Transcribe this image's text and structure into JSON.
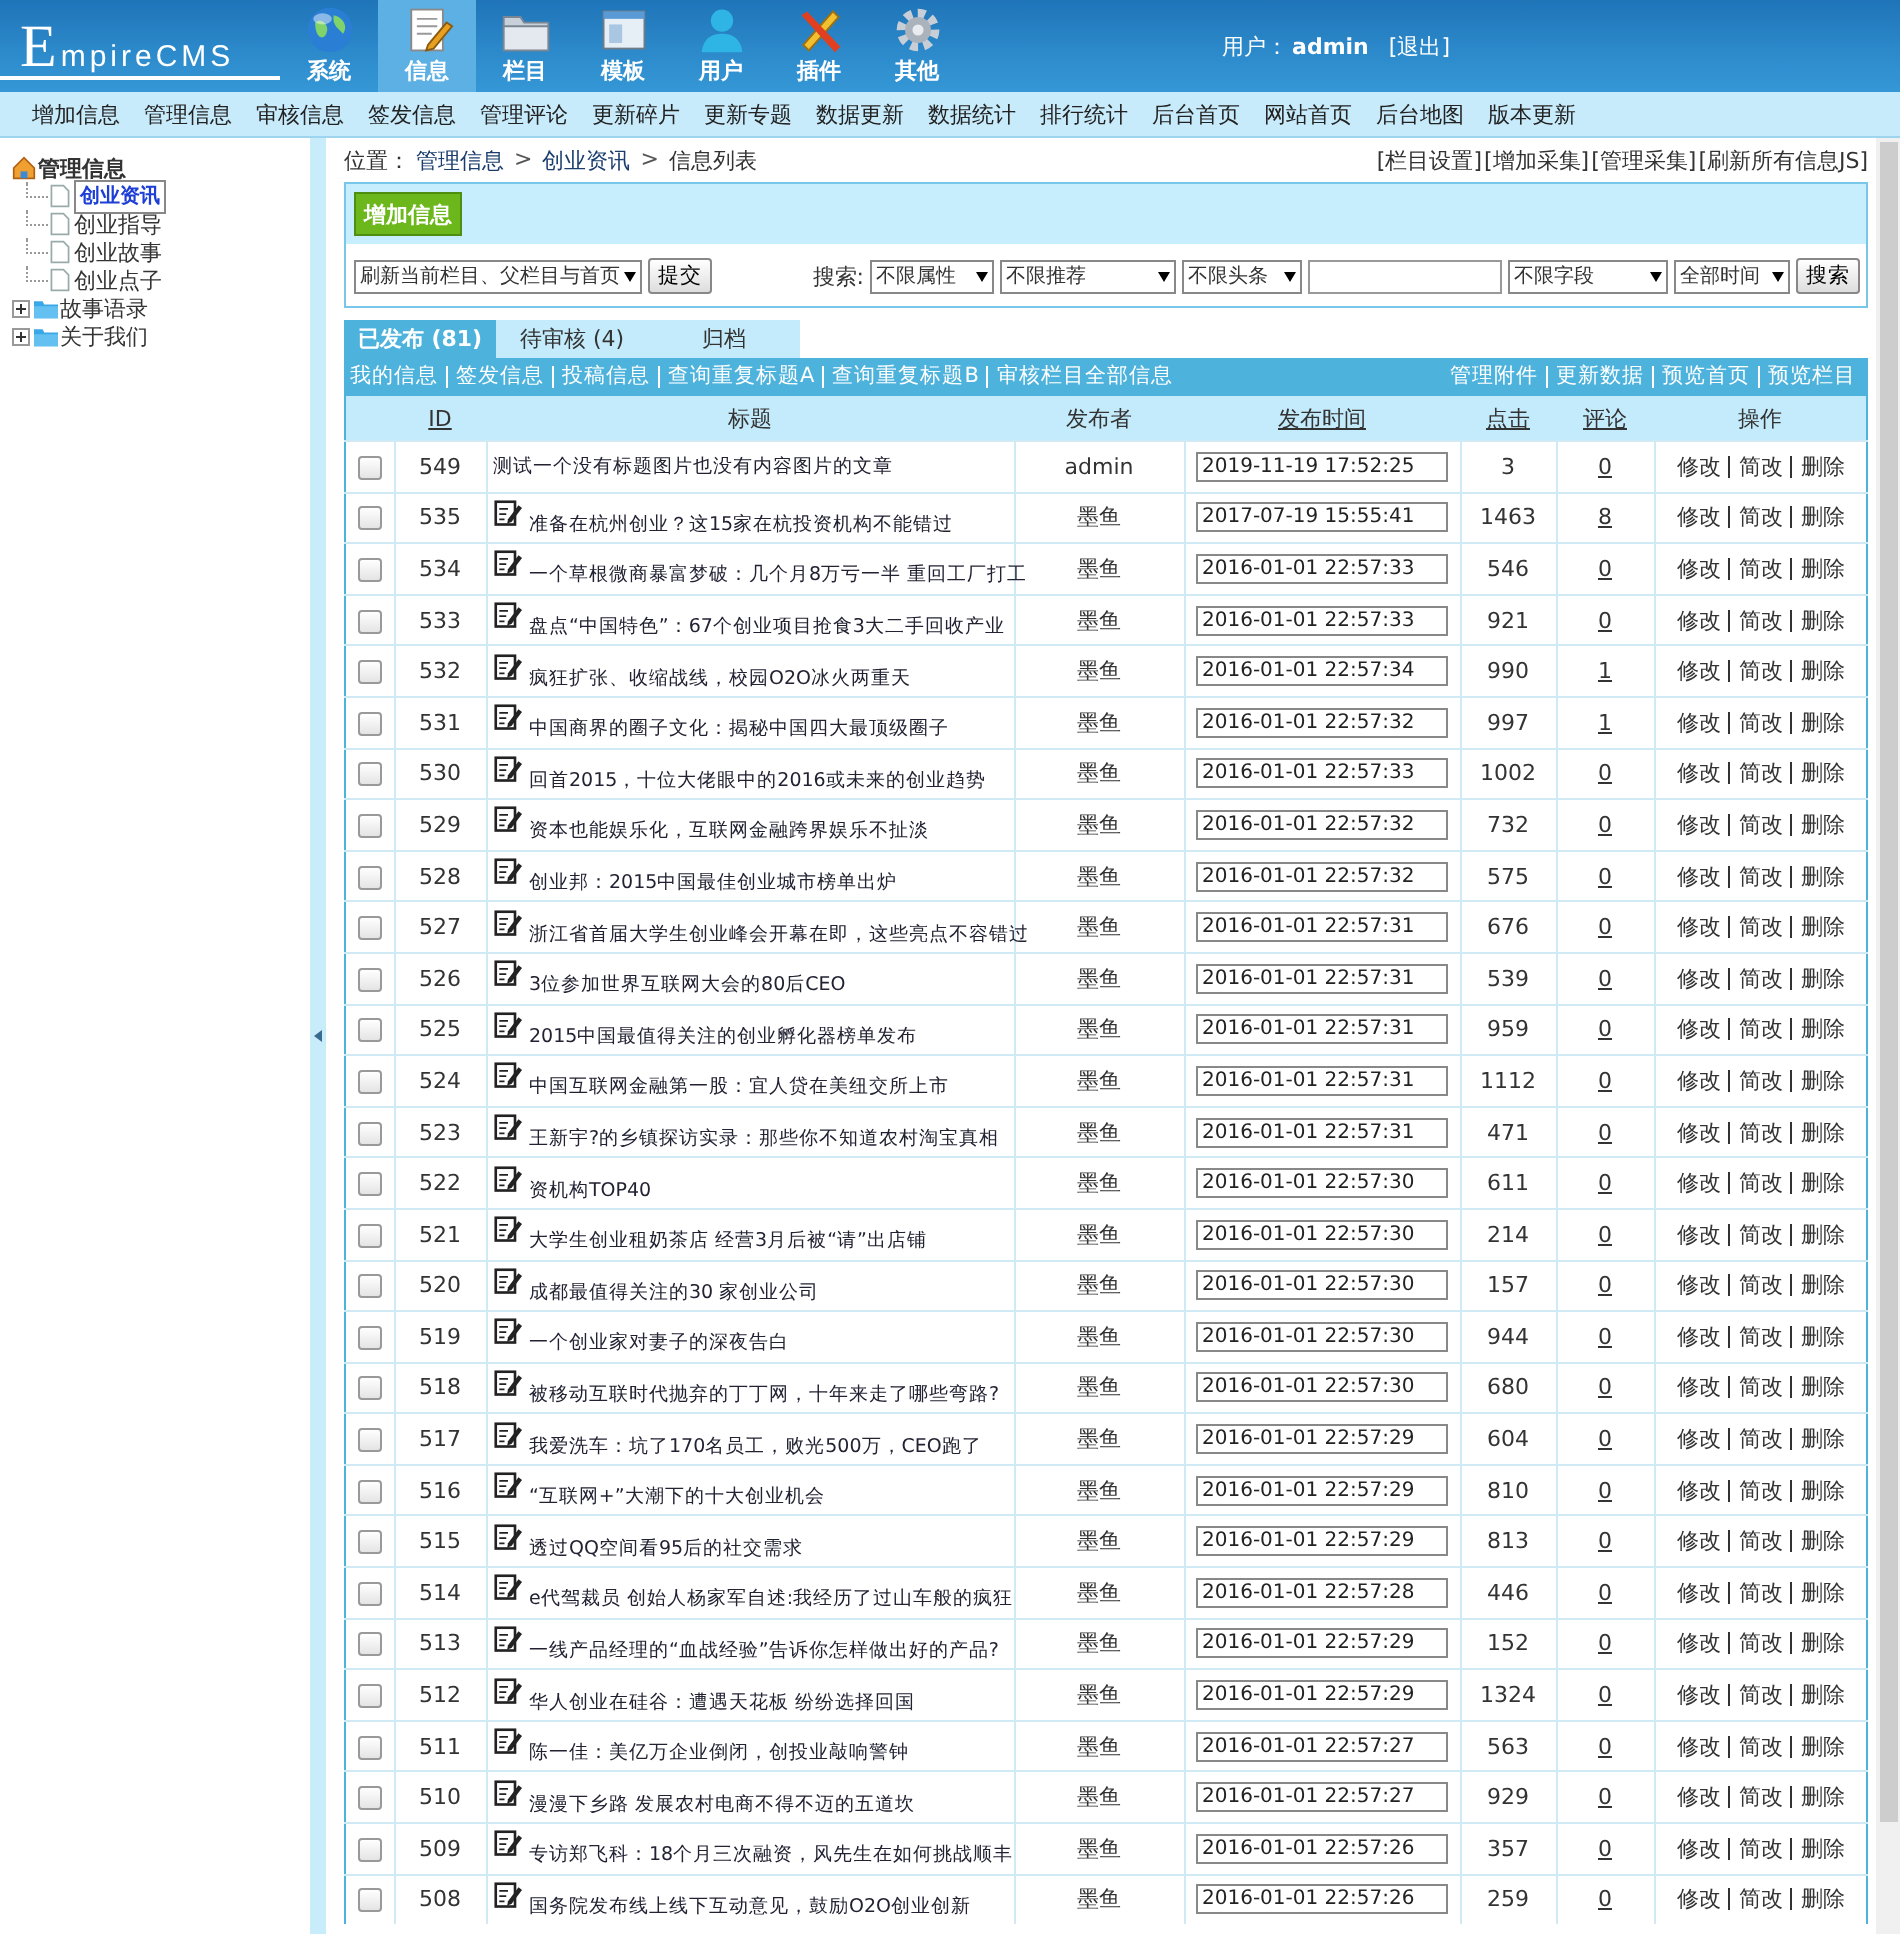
{
  "header": {
    "logo": "EmpireCMS",
    "nav": [
      {
        "label": "系统",
        "selected": false
      },
      {
        "label": "信息",
        "selected": true
      },
      {
        "label": "栏目",
        "selected": false
      },
      {
        "label": "模板",
        "selected": false
      },
      {
        "label": "用户",
        "selected": false
      },
      {
        "label": "插件",
        "selected": false
      },
      {
        "label": "其他",
        "selected": false
      }
    ],
    "user": {
      "label": "用户：",
      "name": "admin",
      "logout": "[退出]"
    }
  },
  "menu": [
    "增加信息",
    "管理信息",
    "审核信息",
    "签发信息",
    "管理评论",
    "更新碎片",
    "更新专题",
    "数据更新",
    "数据统计",
    "排行统计",
    "后台首页",
    "网站首页",
    "后台地图",
    "版本更新"
  ],
  "sidebar": {
    "tree": [
      {
        "label": "管理信息",
        "kind": "root",
        "expanded": true,
        "children": [
          {
            "label": "创业资讯",
            "kind": "page",
            "selected": true
          },
          {
            "label": "创业指导",
            "kind": "page",
            "selected": false
          },
          {
            "label": "创业故事",
            "kind": "page",
            "selected": false
          },
          {
            "label": "创业点子",
            "kind": "page",
            "selected": false
          }
        ]
      },
      {
        "label": "故事语录",
        "kind": "folder",
        "expanded": false
      },
      {
        "label": "关于我们",
        "kind": "folder",
        "expanded": false
      }
    ]
  },
  "breadcrumb": {
    "label": "位置：",
    "parts": [
      {
        "text": "管理信息",
        "kind": "link"
      },
      {
        "text": ">",
        "kind": "sep"
      },
      {
        "text": "创业资讯",
        "kind": "link"
      },
      {
        "text": ">",
        "kind": "sep"
      },
      {
        "text": "信息列表",
        "kind": "text"
      }
    ]
  },
  "top_links": [
    "[栏目设置]",
    "[增加采集]",
    "[管理采集]",
    "[刷新所有信息JS]"
  ],
  "toolbar": {
    "add_button": "增加信息",
    "refresh_select": "刷新当前栏目、父栏目与首页",
    "submit_button": "提交",
    "search_label": "搜索:",
    "filters": [
      "不限属性",
      "不限推荐",
      "不限头条"
    ],
    "field_select": "不限字段",
    "time_select": "全部时间",
    "search_button": "搜索"
  },
  "tabs": [
    {
      "label": "已发布 (81)",
      "selected": true
    },
    {
      "label": "待审核 (4)",
      "selected": false
    },
    {
      "label": "归档",
      "selected": false
    }
  ],
  "links_left": [
    "我的信息",
    "签发信息",
    "投稿信息",
    "查询重复标题A",
    "查询重复标题B",
    "审核栏目全部信息"
  ],
  "links_right": [
    "管理附件",
    "更新数据",
    "预览首页",
    "预览栏目"
  ],
  "table": {
    "columns": [
      {
        "label": "ID",
        "link": true
      },
      {
        "label": "标题",
        "link": false
      },
      {
        "label": "发布者",
        "link": false
      },
      {
        "label": "发布时间",
        "link": true
      },
      {
        "label": "点击",
        "link": true
      },
      {
        "label": "评论",
        "link": true
      },
      {
        "label": "操作",
        "link": false
      }
    ],
    "rows": [
      {
        "checked": false,
        "id": "549",
        "has_image": false,
        "title": "测试一个没有标题图片也没有内容图片的文章",
        "publisher": "admin",
        "time": "2019-11-19 17:52:25",
        "clicks": "3",
        "comments": "0",
        "actions": [
          "修改",
          "简改",
          "删除"
        ]
      },
      {
        "checked": false,
        "id": "535",
        "has_image": true,
        "title": "准备在杭州创业？这15家在杭投资机构不能错过",
        "publisher": "墨鱼",
        "time": "2017-07-19 15:55:41",
        "clicks": "1463",
        "comments": "8",
        "actions": [
          "修改",
          "简改",
          "删除"
        ]
      },
      {
        "checked": false,
        "id": "534",
        "has_image": true,
        "title": "一个草根微商暴富梦破：几个月8万亏一半 重回工厂打工",
        "publisher": "墨鱼",
        "time": "2016-01-01 22:57:33",
        "clicks": "546",
        "comments": "0",
        "actions": [
          "修改",
          "简改",
          "删除"
        ]
      },
      {
        "checked": false,
        "id": "533",
        "has_image": true,
        "title": "盘点“中国特色”：67个创业项目抢食3大二手回收产业",
        "publisher": "墨鱼",
        "time": "2016-01-01 22:57:33",
        "clicks": "921",
        "comments": "0",
        "actions": [
          "修改",
          "简改",
          "删除"
        ]
      },
      {
        "checked": false,
        "id": "532",
        "has_image": true,
        "title": "疯狂扩张、收缩战线，校园O2O冰火两重天",
        "publisher": "墨鱼",
        "time": "2016-01-01 22:57:34",
        "clicks": "990",
        "comments": "1",
        "actions": [
          "修改",
          "简改",
          "删除"
        ]
      },
      {
        "checked": false,
        "id": "531",
        "has_image": true,
        "title": "中国商界的圈子文化：揭秘中国四大最顶级圈子",
        "publisher": "墨鱼",
        "time": "2016-01-01 22:57:32",
        "clicks": "997",
        "comments": "1",
        "actions": [
          "修改",
          "简改",
          "删除"
        ]
      },
      {
        "checked": false,
        "id": "530",
        "has_image": true,
        "title": "回首2015，十位大佬眼中的2016或未来的创业趋势",
        "publisher": "墨鱼",
        "time": "2016-01-01 22:57:33",
        "clicks": "1002",
        "comments": "0",
        "actions": [
          "修改",
          "简改",
          "删除"
        ]
      },
      {
        "checked": false,
        "id": "529",
        "has_image": true,
        "title": "资本也能娱乐化，互联网金融跨界娱乐不扯淡",
        "publisher": "墨鱼",
        "time": "2016-01-01 22:57:32",
        "clicks": "732",
        "comments": "0",
        "actions": [
          "修改",
          "简改",
          "删除"
        ]
      },
      {
        "checked": false,
        "id": "528",
        "has_image": true,
        "title": "创业邦：2015中国最佳创业城市榜单出炉",
        "publisher": "墨鱼",
        "time": "2016-01-01 22:57:32",
        "clicks": "575",
        "comments": "0",
        "actions": [
          "修改",
          "简改",
          "删除"
        ]
      },
      {
        "checked": false,
        "id": "527",
        "has_image": true,
        "title": "浙江省首届大学生创业峰会开幕在即，这些亮点不容错过",
        "publisher": "墨鱼",
        "time": "2016-01-01 22:57:31",
        "clicks": "676",
        "comments": "0",
        "actions": [
          "修改",
          "简改",
          "删除"
        ]
      },
      {
        "checked": false,
        "id": "526",
        "has_image": true,
        "title": "3位参加世界互联网大会的80后CEO",
        "publisher": "墨鱼",
        "time": "2016-01-01 22:57:31",
        "clicks": "539",
        "comments": "0",
        "actions": [
          "修改",
          "简改",
          "删除"
        ]
      },
      {
        "checked": false,
        "id": "525",
        "has_image": true,
        "title": "2015中国最值得关注的创业孵化器榜单发布",
        "publisher": "墨鱼",
        "time": "2016-01-01 22:57:31",
        "clicks": "959",
        "comments": "0",
        "actions": [
          "修改",
          "简改",
          "删除"
        ]
      },
      {
        "checked": false,
        "id": "524",
        "has_image": true,
        "title": "中国互联网金融第一股：宜人贷在美纽交所上市",
        "publisher": "墨鱼",
        "time": "2016-01-01 22:57:31",
        "clicks": "1112",
        "comments": "0",
        "actions": [
          "修改",
          "简改",
          "删除"
        ]
      },
      {
        "checked": false,
        "id": "523",
        "has_image": true,
        "title": "王新宇?的乡镇探访实录：那些你不知道农村淘宝真相",
        "publisher": "墨鱼",
        "time": "2016-01-01 22:57:31",
        "clicks": "471",
        "comments": "0",
        "actions": [
          "修改",
          "简改",
          "删除"
        ]
      },
      {
        "checked": false,
        "id": "522",
        "has_image": true,
        "title": "资机构TOP40",
        "publisher": "墨鱼",
        "time": "2016-01-01 22:57:30",
        "clicks": "611",
        "comments": "0",
        "actions": [
          "修改",
          "简改",
          "删除"
        ]
      },
      {
        "checked": false,
        "id": "521",
        "has_image": true,
        "title": "大学生创业租奶茶店 经营3月后被“请”出店铺",
        "publisher": "墨鱼",
        "time": "2016-01-01 22:57:30",
        "clicks": "214",
        "comments": "0",
        "actions": [
          "修改",
          "简改",
          "删除"
        ]
      },
      {
        "checked": false,
        "id": "520",
        "has_image": true,
        "title": "成都最值得关注的30 家创业公司",
        "publisher": "墨鱼",
        "time": "2016-01-01 22:57:30",
        "clicks": "157",
        "comments": "0",
        "actions": [
          "修改",
          "简改",
          "删除"
        ]
      },
      {
        "checked": false,
        "id": "519",
        "has_image": true,
        "title": "一个创业家对妻子的深夜告白",
        "publisher": "墨鱼",
        "time": "2016-01-01 22:57:30",
        "clicks": "944",
        "comments": "0",
        "actions": [
          "修改",
          "简改",
          "删除"
        ]
      },
      {
        "checked": false,
        "id": "518",
        "has_image": true,
        "title": "被移动互联时代抛弃的丁丁网，十年来走了哪些弯路?",
        "publisher": "墨鱼",
        "time": "2016-01-01 22:57:30",
        "clicks": "680",
        "comments": "0",
        "actions": [
          "修改",
          "简改",
          "删除"
        ]
      },
      {
        "checked": false,
        "id": "517",
        "has_image": true,
        "title": "我爱洗车：坑了170名员工，败光500万，CEO跑了",
        "publisher": "墨鱼",
        "time": "2016-01-01 22:57:29",
        "clicks": "604",
        "comments": "0",
        "actions": [
          "修改",
          "简改",
          "删除"
        ]
      },
      {
        "checked": false,
        "id": "516",
        "has_image": true,
        "title": "“互联网+”大潮下的十大创业机会",
        "publisher": "墨鱼",
        "time": "2016-01-01 22:57:29",
        "clicks": "810",
        "comments": "0",
        "actions": [
          "修改",
          "简改",
          "删除"
        ]
      },
      {
        "checked": false,
        "id": "515",
        "has_image": true,
        "title": "透过QQ空间看95后的社交需求",
        "publisher": "墨鱼",
        "time": "2016-01-01 22:57:29",
        "clicks": "813",
        "comments": "0",
        "actions": [
          "修改",
          "简改",
          "删除"
        ]
      },
      {
        "checked": false,
        "id": "514",
        "has_image": true,
        "title": "e代驾裁员 创始人杨家军自述:我经历了过山车般的疯狂",
        "publisher": "墨鱼",
        "time": "2016-01-01 22:57:28",
        "clicks": "446",
        "comments": "0",
        "actions": [
          "修改",
          "简改",
          "删除"
        ]
      },
      {
        "checked": false,
        "id": "513",
        "has_image": true,
        "title": "一线产品经理的“血战经验”告诉你怎样做出好的产品?",
        "publisher": "墨鱼",
        "time": "2016-01-01 22:57:29",
        "clicks": "152",
        "comments": "0",
        "actions": [
          "修改",
          "简改",
          "删除"
        ]
      },
      {
        "checked": false,
        "id": "512",
        "has_image": true,
        "title": "华人创业在硅谷：遭遇天花板 纷纷选择回国",
        "publisher": "墨鱼",
        "time": "2016-01-01 22:57:29",
        "clicks": "1324",
        "comments": "0",
        "actions": [
          "修改",
          "简改",
          "删除"
        ]
      },
      {
        "checked": false,
        "id": "511",
        "has_image": true,
        "title": "陈一佳：美亿万企业倒闭，创投业敲响警钟",
        "publisher": "墨鱼",
        "time": "2016-01-01 22:57:27",
        "clicks": "563",
        "comments": "0",
        "actions": [
          "修改",
          "简改",
          "删除"
        ]
      },
      {
        "checked": false,
        "id": "510",
        "has_image": true,
        "title": "漫漫下乡路 发展农村电商不得不迈的五道坎",
        "publisher": "墨鱼",
        "time": "2016-01-01 22:57:27",
        "clicks": "929",
        "comments": "0",
        "actions": [
          "修改",
          "简改",
          "删除"
        ]
      },
      {
        "checked": false,
        "id": "509",
        "has_image": true,
        "title": "专访郑飞科：18个月三次融资，风先生在如何挑战顺丰",
        "publisher": "墨鱼",
        "time": "2016-01-01 22:57:26",
        "clicks": "357",
        "comments": "0",
        "actions": [
          "修改",
          "简改",
          "删除"
        ]
      },
      {
        "checked": false,
        "id": "508",
        "has_image": true,
        "title": "国务院发布线上线下互动意见，鼓励O2O创业创新",
        "publisher": "墨鱼",
        "time": "2016-01-01 22:57:26",
        "clicks": "259",
        "comments": "0",
        "actions": [
          "修改",
          "简改",
          "删除"
        ]
      }
    ]
  }
}
